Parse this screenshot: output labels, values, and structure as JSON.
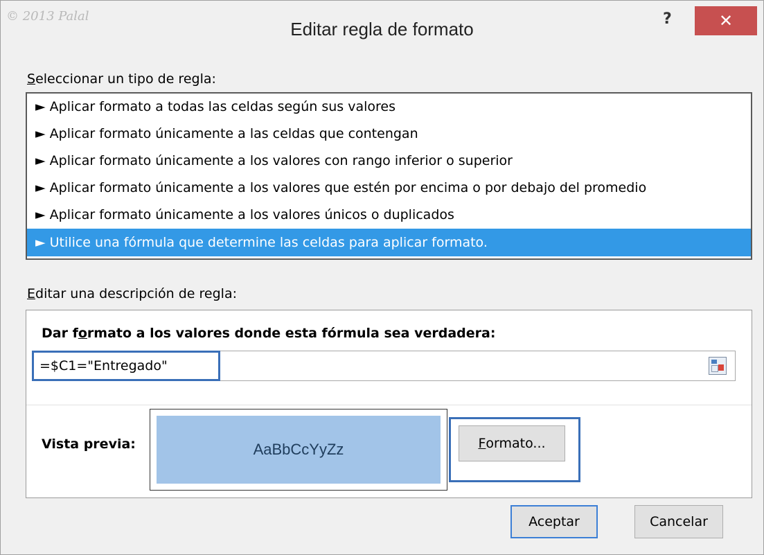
{
  "titlebar": {
    "watermark": "© 2013 Palal",
    "title": "Editar regla de formato",
    "help_glyph": "?",
    "close_glyph": "✕"
  },
  "rule_type": {
    "label_first": "S",
    "label_rest": "eleccionar un tipo de regla:",
    "items": [
      "► Aplicar formato a todas las celdas según sus valores",
      "► Aplicar formato únicamente a las celdas que contengan",
      "► Aplicar formato únicamente a los valores con rango inferior o superior",
      "► Aplicar formato únicamente a los valores que estén por encima o por debajo del promedio",
      "► Aplicar formato únicamente a los valores únicos o duplicados",
      "► Utilice una fórmula que determine las celdas para aplicar formato."
    ],
    "selected_index": 5
  },
  "description": {
    "label_first": "E",
    "label_rest": "ditar una descripción de regla:",
    "heading_pre": "Dar f",
    "heading_u": "o",
    "heading_post": "rmato a los valores donde esta fórmula sea verdadera:",
    "formula": "=$C1=\"Entregado\"",
    "preview_label": "Vista previa:",
    "preview_text": "AaBbCcYyZz",
    "format_btn_first": "F",
    "format_btn_rest": "ormato..."
  },
  "buttons": {
    "ok": "Aceptar",
    "cancel": "Cancelar"
  },
  "colors": {
    "selection": "#3399e6",
    "preview_fill": "#a2c4e8",
    "highlight": "#3a6fb8",
    "close": "#c75050"
  }
}
